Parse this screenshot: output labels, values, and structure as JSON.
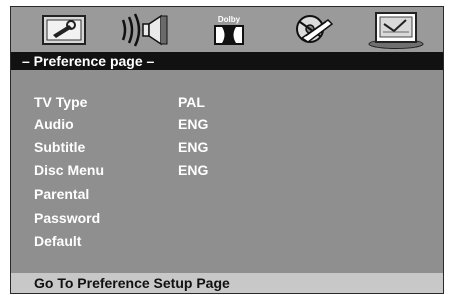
{
  "tabs": [
    {
      "icon": "general-setup-icon"
    },
    {
      "icon": "audio-setup-icon"
    },
    {
      "icon": "dolby-digital-icon",
      "label": "Dolby"
    },
    {
      "icon": "video-setup-icon"
    },
    {
      "icon": "preference-setup-icon"
    }
  ],
  "title": "– Preference page –",
  "menu": [
    {
      "label": "TV Type",
      "value": "PAL"
    },
    {
      "label": "Audio",
      "value": "ENG"
    },
    {
      "label": "Subtitle",
      "value": "ENG"
    },
    {
      "label": "Disc Menu",
      "value": "ENG"
    },
    {
      "label": "Parental",
      "value": ""
    },
    {
      "label": "Password",
      "value": ""
    },
    {
      "label": "Default",
      "value": ""
    }
  ],
  "status": "Go To Preference Setup Page",
  "colors": {
    "panel": "#8f8f8f",
    "titlebar": "#111111",
    "statusbar": "#c8c8c8",
    "text": "#ffffff"
  }
}
